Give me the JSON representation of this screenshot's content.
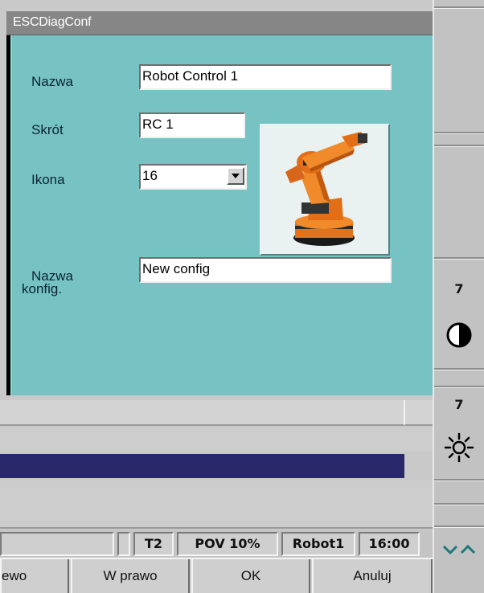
{
  "dialog": {
    "title": "ESCDiagConf",
    "name_label": "Nazwa",
    "name_value": "Robot Control 1",
    "short_label": "Skrót",
    "short_value": "RC 1",
    "icon_label": "Ikona",
    "icon_value": "16",
    "config_label_line1": "Nazwa",
    "config_label_line2": "konfig.",
    "config_value": "New config",
    "robot_image_icon": "robot-arm-icon"
  },
  "status_bar": {
    "mode": "T2",
    "pov": "POV 10%",
    "robot": "Robot1",
    "time": "16:00"
  },
  "softkeys": {
    "left": "ewo",
    "right": "W prawo",
    "ok": "OK",
    "cancel": "Anuluj"
  },
  "right_panel": {
    "contrast_value": "7",
    "contrast_icon": "contrast-icon",
    "brightness_value": "7",
    "brightness_icon": "brightness-icon",
    "expand_icon": "chevrons-up-icon",
    "chevron_color": "#1a7a7e"
  },
  "colors": {
    "dialog_bg": "#77c3c4",
    "titlebar": "#868686",
    "progress": "#28286a"
  }
}
